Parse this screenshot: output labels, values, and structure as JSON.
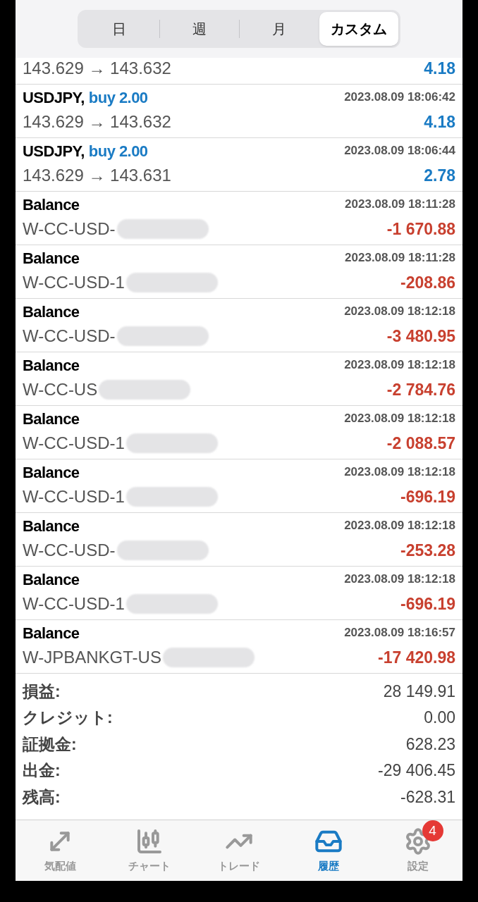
{
  "period_tabs": [
    {
      "label": "日",
      "selected": false
    },
    {
      "label": "週",
      "selected": false
    },
    {
      "label": "月",
      "selected": false
    },
    {
      "label": "カスタム",
      "selected": true
    }
  ],
  "history": [
    {
      "kind": "trade",
      "detail": "143.629 → 143.632",
      "profit": "4.18",
      "loss": false
    },
    {
      "kind": "trade",
      "symbol": "USDJPY,",
      "side": "buy 2.00",
      "time": "2023.08.09 18:06:42",
      "detail": "143.629 → 143.632",
      "profit": "4.18",
      "loss": false
    },
    {
      "kind": "trade",
      "symbol": "USDJPY,",
      "side": "buy 2.00",
      "time": "2023.08.09 18:06:44",
      "detail": "143.629 → 143.631",
      "profit": "2.78",
      "loss": false
    },
    {
      "kind": "balance",
      "symbol": "Balance",
      "time": "2023.08.09 18:11:28",
      "detail": "W-CC-USD-",
      "profit": "-1 670.88",
      "loss": true
    },
    {
      "kind": "balance",
      "symbol": "Balance",
      "time": "2023.08.09 18:11:28",
      "detail": "W-CC-USD-1",
      "profit": "-208.86",
      "loss": true
    },
    {
      "kind": "balance",
      "symbol": "Balance",
      "time": "2023.08.09 18:12:18",
      "detail": "W-CC-USD-",
      "profit": "-3 480.95",
      "loss": true
    },
    {
      "kind": "balance",
      "symbol": "Balance",
      "time": "2023.08.09 18:12:18",
      "detail": "W-CC-US",
      "profit": "-2 784.76",
      "loss": true
    },
    {
      "kind": "balance",
      "symbol": "Balance",
      "time": "2023.08.09 18:12:18",
      "detail": "W-CC-USD-1",
      "profit": "-2 088.57",
      "loss": true
    },
    {
      "kind": "balance",
      "symbol": "Balance",
      "time": "2023.08.09 18:12:18",
      "detail": "W-CC-USD-1",
      "profit": "-696.19",
      "loss": true
    },
    {
      "kind": "balance",
      "symbol": "Balance",
      "time": "2023.08.09 18:12:18",
      "detail": "W-CC-USD-",
      "profit": "-253.28",
      "loss": true
    },
    {
      "kind": "balance",
      "symbol": "Balance",
      "time": "2023.08.09 18:12:18",
      "detail": "W-CC-USD-1",
      "profit": "-696.19",
      "loss": true
    },
    {
      "kind": "balance",
      "symbol": "Balance",
      "time": "2023.08.09 18:16:57",
      "detail": "W-JPBANKGT-US",
      "profit": "-17 420.98",
      "loss": true
    }
  ],
  "summary": [
    {
      "label": "損益:",
      "value": "28 149.91"
    },
    {
      "label": "クレジット:",
      "value": "0.00"
    },
    {
      "label": "証拠金:",
      "value": "628.23"
    },
    {
      "label": "出金:",
      "value": "-29 406.45"
    },
    {
      "label": "残高:",
      "value": "-628.31"
    }
  ],
  "nav": [
    {
      "kind": "quotes",
      "label": "気配値",
      "selected": false
    },
    {
      "kind": "chart",
      "label": "チャート",
      "selected": false
    },
    {
      "kind": "trade",
      "label": "トレード",
      "selected": false
    },
    {
      "kind": "history",
      "label": "履歴",
      "selected": true
    },
    {
      "kind": "settings",
      "label": "設定",
      "selected": false,
      "badge": "4"
    }
  ]
}
